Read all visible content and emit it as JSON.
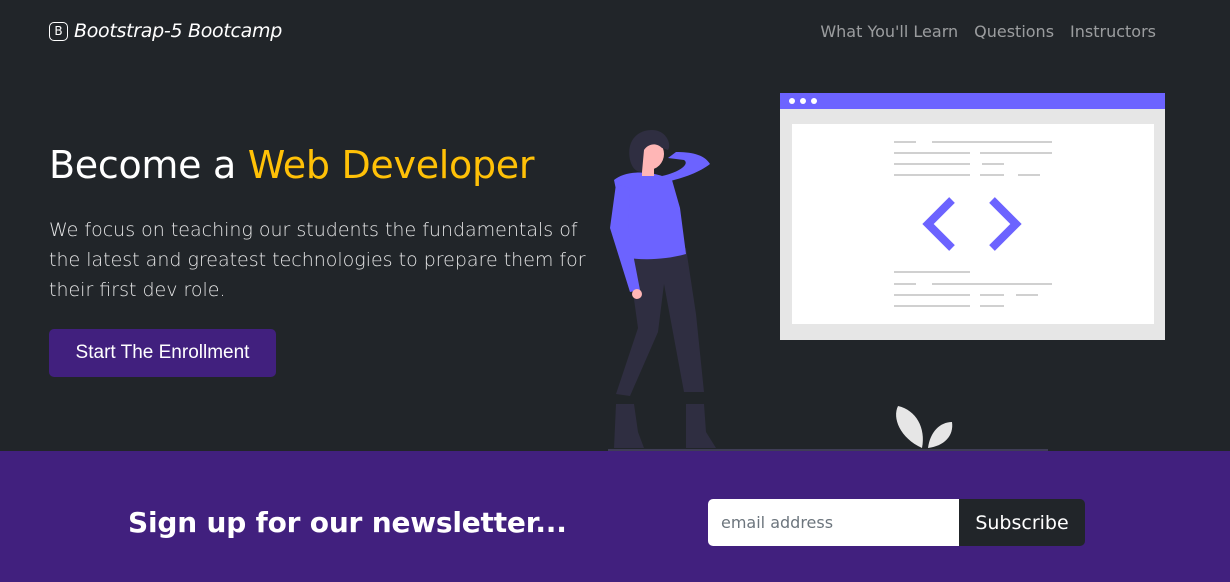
{
  "navbar": {
    "brand_icon": "B",
    "brand_text": "Bootstrap-5 Bootcamp",
    "links": [
      {
        "label": "What You'll Learn"
      },
      {
        "label": "Questions"
      },
      {
        "label": "Instructors"
      }
    ]
  },
  "hero": {
    "title_prefix": "Become a ",
    "title_accent": "Web Developer",
    "lead": "We focus on teaching our students the fundamentals of the latest and greatest technologies to prepare them for their first dev role.",
    "cta_label": "Start The Enrollment"
  },
  "newsletter": {
    "title": "Sign up for our newsletter...",
    "input_placeholder": "email address",
    "input_value": "",
    "button_label": "Subscribe"
  },
  "colors": {
    "background": "#212529",
    "accent": "#ffc107",
    "primary_purple": "#41207e",
    "illustration_purple": "#6c63ff"
  }
}
